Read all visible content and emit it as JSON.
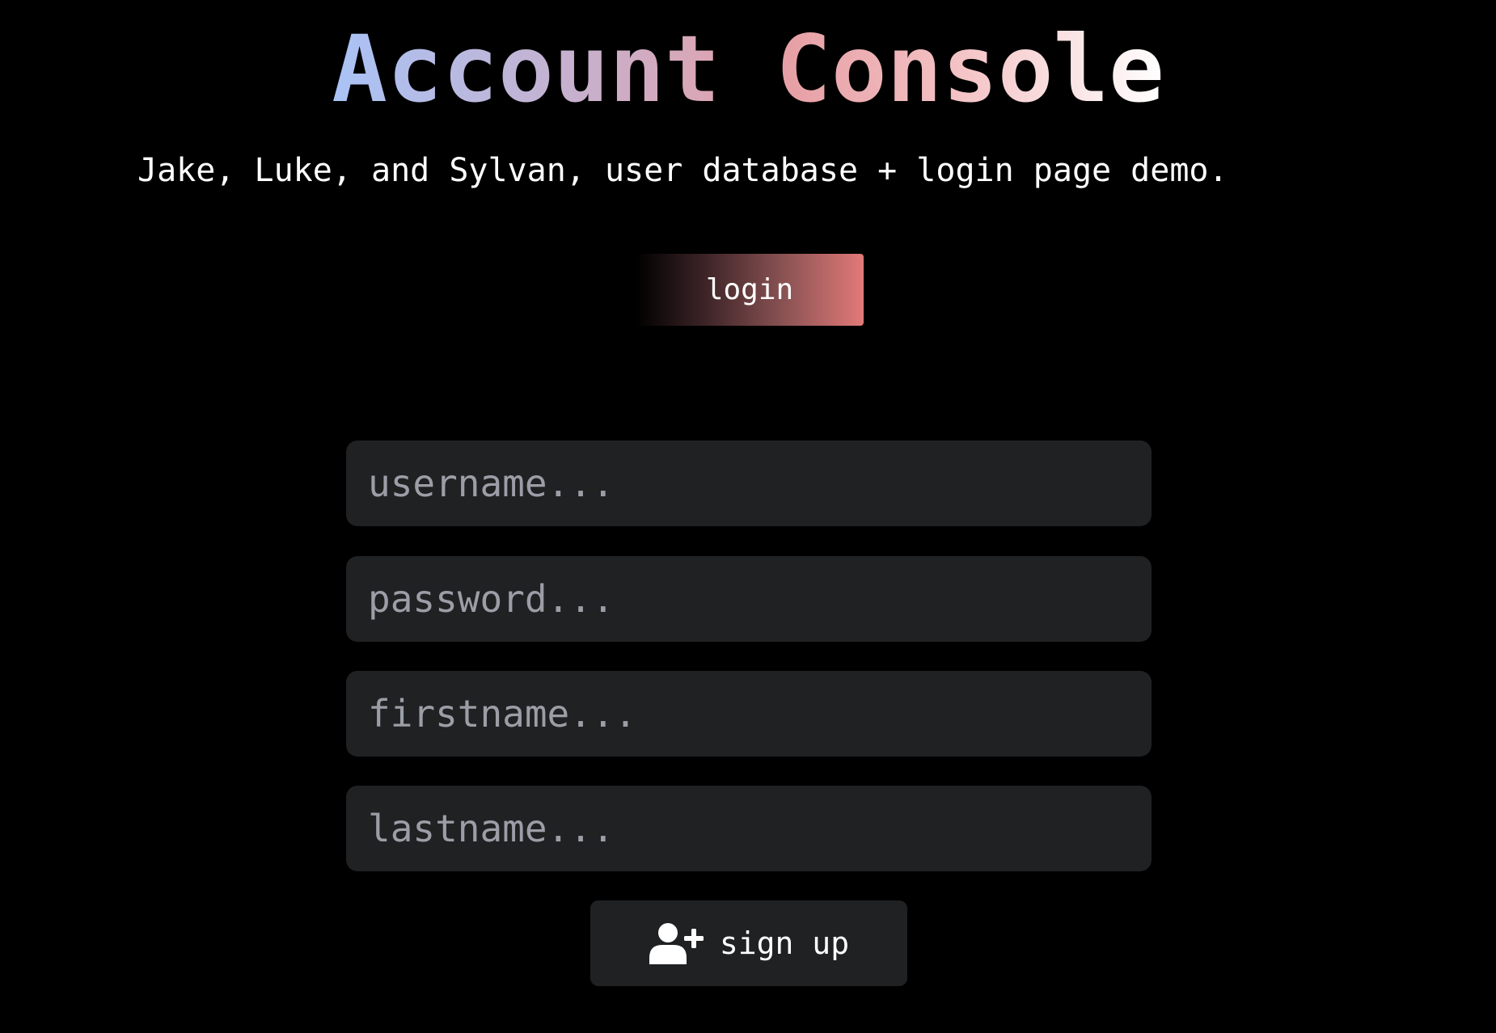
{
  "header": {
    "title": "Account Console",
    "subtitle": "Jake, Luke, and Sylvan, user database + login page demo."
  },
  "login_button": {
    "label": "login"
  },
  "form": {
    "username_placeholder": "username...",
    "password_placeholder": "password...",
    "firstname_placeholder": "firstname...",
    "lastname_placeholder": "lastname..."
  },
  "signup_button": {
    "label": "sign up",
    "icon": "user-plus-icon"
  },
  "colors": {
    "background": "#000000",
    "field_background": "#202123",
    "placeholder": "#9b9ea6",
    "title_gradient_start": "#a9c3f6",
    "title_gradient_end": "#ffffff",
    "login_accent": "#e27a78"
  }
}
